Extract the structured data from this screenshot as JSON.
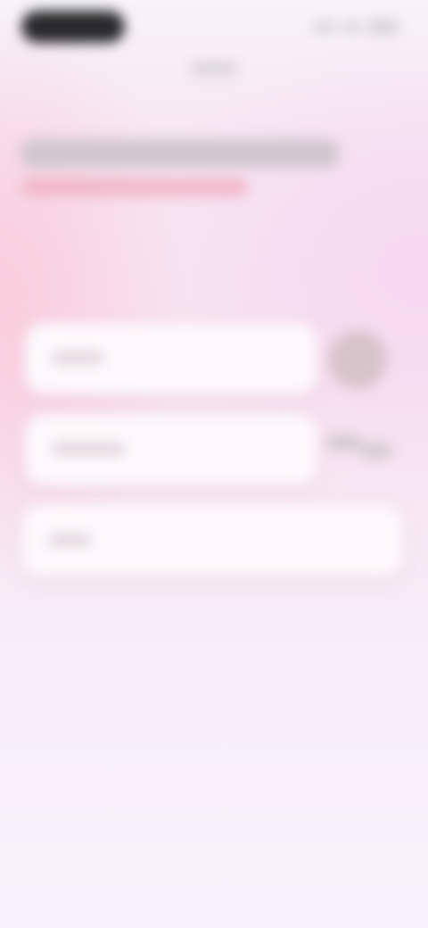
{
  "status_bar": {
    "time": "",
    "icons": [
      "signal-icon",
      "wifi-icon",
      "battery-icon"
    ]
  },
  "header": {
    "title": "",
    "subtitle": ""
  },
  "cards": [
    {
      "label": "",
      "trailing_icon": "avatar"
    },
    {
      "label": "",
      "trailing_icon": "key-icon"
    },
    {
      "label": ""
    }
  ],
  "colors": {
    "accent_pink": "#f1b7c8",
    "card_bg": "#fcf8fb",
    "status_pill": "#2a2a2c"
  }
}
